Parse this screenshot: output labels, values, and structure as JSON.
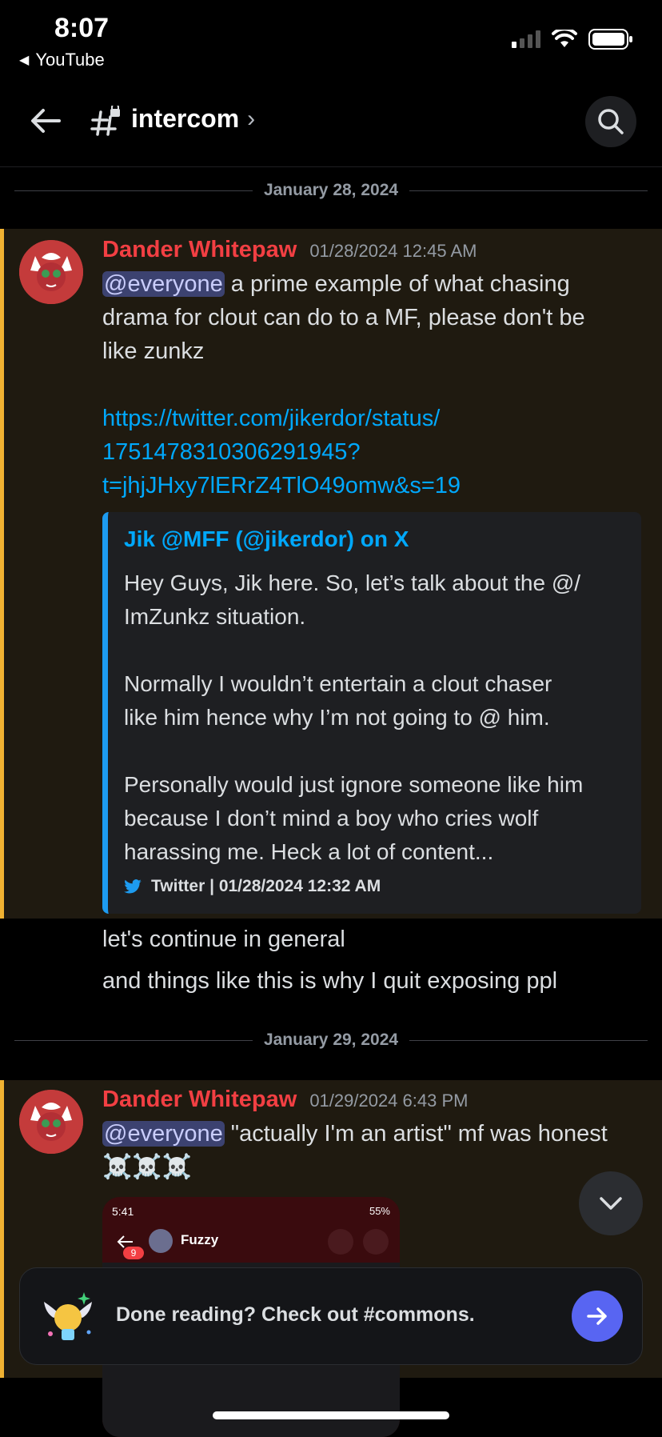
{
  "status_bar": {
    "time": "8:07",
    "back_app": "YouTube"
  },
  "header": {
    "channel_name": "intercom",
    "chevron": "›"
  },
  "messages": [
    {
      "date_separator": "January 28, 2024",
      "author": "Dander Whitepaw",
      "timestamp": "01/28/2024 12:45 AM",
      "mention": "@everyone",
      "text_lines": [
        " a prime example of what chasing",
        "drama for clout can do to a MF, please don't be",
        "like zunkz"
      ],
      "link_lines": [
        "https://twitter.com/jikerdor/status/",
        "1751478310306291945?",
        "t=jhjJHxy7lERrZ4TlO49omw&s=19"
      ],
      "embed": {
        "title": "Jik @MFF (@jikerdor) on X",
        "desc_lines": [
          "Hey Guys, Jik here. So, let’s talk about the @/",
          "ImZunkz situation.",
          "",
          "Normally I wouldn’t entertain a clout chaser",
          "like him hence why I’m not going to @ him.",
          "",
          "Personally would just ignore someone like him",
          "because I don’t mind a boy who cries wolf",
          "harassing me. Heck a lot of content..."
        ],
        "footer": "Twitter | 01/28/2024 12:32 AM"
      },
      "followups": [
        "let's continue in general",
        "and things like this is why I quit exposing ppl"
      ]
    },
    {
      "date_separator": "January 29, 2024",
      "author": "Dander Whitepaw",
      "timestamp": "01/29/2024 6:43 PM",
      "mention": "@everyone",
      "text": " \"actually I'm an artist\" mf was honest",
      "emoji_line": "☠️☠️☠️",
      "attachment": {
        "status_time": "5:41",
        "status_right": "55%",
        "contact_name": "Fuzzy",
        "badge": "9"
      }
    }
  ],
  "banner": {
    "text": "Done reading? Check out #commons."
  },
  "colors": {
    "author": "#f23f43",
    "link": "#00a8fc",
    "mention_bg": "#3c4270",
    "accent": "#5865f2",
    "highlight_bar": "#f0b232",
    "twitter": "#1d9bf0"
  }
}
